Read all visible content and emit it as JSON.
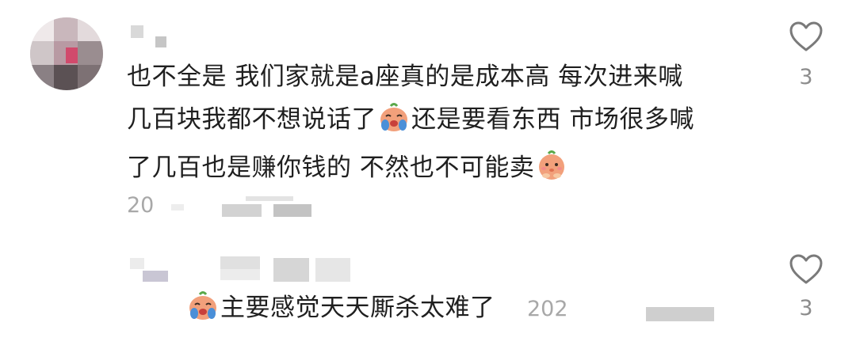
{
  "comments": [
    {
      "lines": [
        "也不全是 我们家就是a座真的是成本高 每次进来喊",
        "几百块我都不想说话了",
        "还是要看东西 市场很多喊",
        "了几百也是赚你钱的 不然也不可能卖"
      ],
      "timestamp": "20",
      "timestamp_suffix": "　",
      "like_count": "3",
      "emojis": [
        "crying-face-emoji",
        "shy-face-emoji"
      ]
    },
    {
      "text": "主要感觉天天厮杀太难了",
      "timestamp": "202",
      "like_count": "3",
      "emojis": [
        "crying-face-emoji"
      ]
    }
  ],
  "icons": {
    "like": "heart-outline-icon"
  },
  "colors": {
    "text": "#1f1f1f",
    "meta": "#a8a8a8",
    "heart_stroke": "#7a7a7a",
    "emoji_skin": "#f2a07b",
    "emoji_blue": "#4a8fd8"
  }
}
